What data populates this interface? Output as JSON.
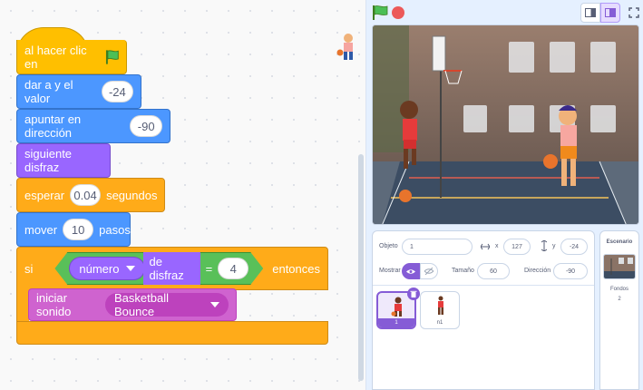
{
  "code_blocks": {
    "when_flag": "al hacer clic en",
    "set_y_label": "dar a y el valor",
    "set_y_value": "-24",
    "point_dir_label": "apuntar en dirección",
    "point_dir_value": "-90",
    "next_costume": "siguiente disfraz",
    "wait_label": "esperar",
    "wait_value": "0.04",
    "wait_unit": "segundos",
    "move_label": "mover",
    "move_value": "10",
    "move_unit": "pasos",
    "if_label": "si",
    "if_then": "entonces",
    "costume_prop": "número",
    "costume_of": "de disfraz",
    "equals": "=",
    "compare_value": "4",
    "start_sound_label": "iniciar sonido",
    "sound_name": "Basketball Bounce"
  },
  "sprite_info": {
    "sprite_label": "Objeto",
    "sprite_name": "1",
    "x_label": "x",
    "x_value": "127",
    "y_label": "y",
    "y_value": "-24",
    "show_label": "Mostrar",
    "size_label": "Tamaño",
    "size_value": "60",
    "direction_label": "Dirección",
    "direction_value": "-90"
  },
  "sprites": [
    {
      "name": "1",
      "selected": true
    },
    {
      "name": "n1",
      "selected": false
    }
  ],
  "stage_panel": {
    "title": "Escenario",
    "backdrops_label": "Fondos",
    "backdrops_count": "2"
  },
  "colors": {
    "events": "#ffbf00",
    "motion": "#4c97ff",
    "looks": "#9966ff",
    "control": "#ffab19",
    "operators": "#59c059",
    "sound": "#cf63cf",
    "accent": "#855cd6"
  }
}
